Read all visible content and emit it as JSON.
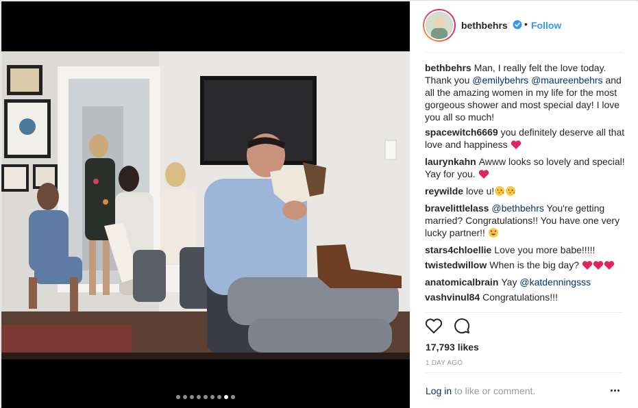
{
  "post": {
    "carousel": {
      "total": 9,
      "active": 7
    }
  },
  "header": {
    "username": "bethbehrs",
    "separator": "•",
    "follow_label": "Follow"
  },
  "caption": {
    "username": "bethbehrs",
    "text_1": "Man, I really felt the love today. Thank you ",
    "mention_1": "@emilybehrs",
    "text_2": " ",
    "mention_2": "@maureenbehrs",
    "text_3": " and all the amazing women in my life for the most gorgeous shower and most special day! I love you all so much!"
  },
  "comments": [
    {
      "username": "spacewitch6669",
      "text": "you definitely deserve all that love and happiness"
    },
    {
      "username": "laurynkahn",
      "text": "Awww looks so lovely and special! Yay for you."
    },
    {
      "username": "reywilde",
      "text": "love u!"
    },
    {
      "username": "bravelittlelass",
      "mention": "@bethbehrs",
      "text": " You're getting married? Congratulations!! You have one very lucky partner!!"
    },
    {
      "username": "stars4chloellie",
      "text": "Love you more babe!!!!!"
    },
    {
      "username": "twistedwillow",
      "text": "When is the big day?"
    },
    {
      "username": "anatomicalbrain",
      "text": "Yay",
      "mention": "@katdenningsss"
    },
    {
      "username": "vashvinul84",
      "text": "Congratulations!!!"
    }
  ],
  "stats": {
    "likes": "17,793 likes",
    "date": "1 DAY AGO"
  },
  "footer": {
    "login_label": "Log in",
    "login_suffix": " to like or comment."
  },
  "icons": {
    "verified": "verified-badge-icon",
    "like": "heart-outline-icon",
    "comment": "speech-bubble-icon",
    "more": "ellipsis-icon"
  },
  "colors": {
    "link_blue": "#3897f0",
    "mention": "#003569",
    "muted": "#999999",
    "heart_red": "#e0245e"
  }
}
